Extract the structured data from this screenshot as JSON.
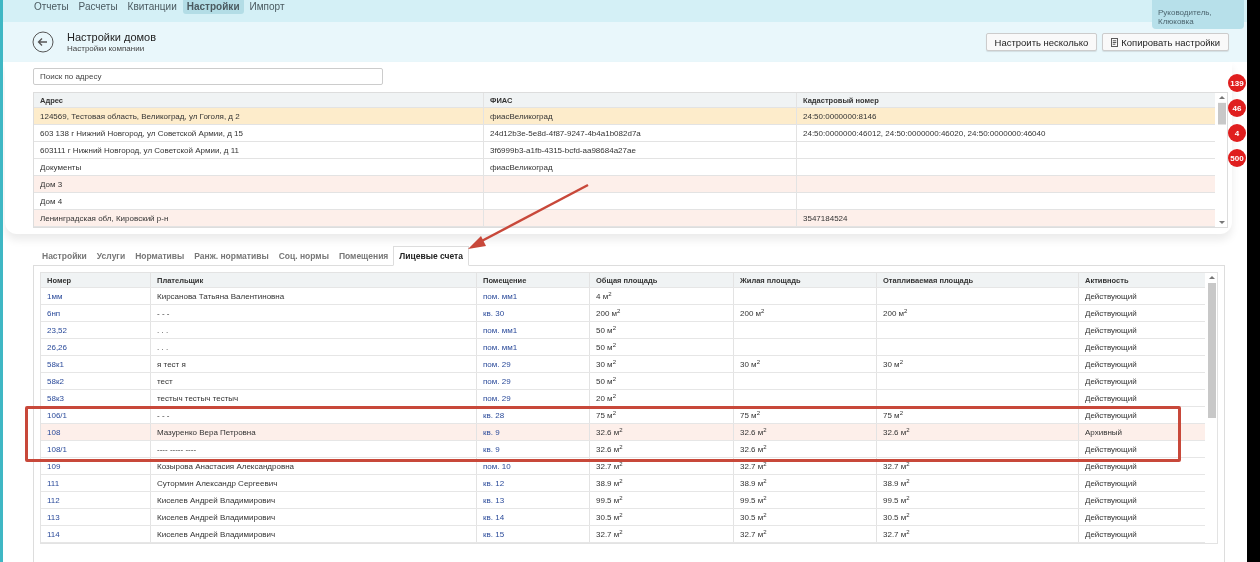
{
  "nav": {
    "items": [
      {
        "label": "Отчеты",
        "selected": false
      },
      {
        "label": "Расчеты",
        "selected": false
      },
      {
        "label": "Квитанции",
        "selected": false
      },
      {
        "label": "Настройки",
        "selected": true
      },
      {
        "label": "Импорт",
        "selected": false
      }
    ],
    "user_role": "Руководитель, Клюковка"
  },
  "header": {
    "title": "Настройки домов",
    "subtitle": "Настройки компании",
    "buttons": [
      {
        "label": "Настроить несколько",
        "kind": "plain"
      },
      {
        "label": "Копировать настройки",
        "kind": "copy"
      }
    ]
  },
  "badges": [
    "139",
    "46",
    "4",
    "500"
  ],
  "search": {
    "placeholder": "Поиск по адресу"
  },
  "houses": {
    "columns": [
      "Адрес",
      "ФИАС",
      "Кадастровый номер"
    ],
    "rows": [
      {
        "cells": [
          "124569, Тестовая область, Великоград, ул Гоголя, д 2",
          "фиасВеликоград",
          "24:50:0000000:8146"
        ],
        "selected": true,
        "highlighted": false
      },
      {
        "cells": [
          "603 138 г Нижний Новгород, ул Советской Армии, д 15",
          "24d12b3e-5e8d-4f87-9247-4b4a1b082d7a",
          "24:50:0000000:46012, 24:50:0000000:46020, 24:50:0000000:46040"
        ],
        "selected": false,
        "highlighted": false
      },
      {
        "cells": [
          "603111 г Нижний Новгород, ул Советской Армии, д 11",
          "3f6999b3-a1fb-4315-bcfd-aa98684a27ae",
          ""
        ],
        "selected": false,
        "highlighted": false
      },
      {
        "cells": [
          "Документы",
          "фиасВеликоград",
          ""
        ],
        "selected": false,
        "highlighted": false
      },
      {
        "cells": [
          "Дом 3",
          "",
          ""
        ],
        "selected": false,
        "highlighted": true
      },
      {
        "cells": [
          "Дом 4",
          "",
          ""
        ],
        "selected": false,
        "highlighted": false
      },
      {
        "cells": [
          "Ленинградская обл, Кировский р-н",
          "",
          "3547184524"
        ],
        "selected": false,
        "highlighted": true
      }
    ]
  },
  "tabs": [
    {
      "label": "Настройки",
      "selected": false
    },
    {
      "label": "Услуги",
      "selected": false
    },
    {
      "label": "Нормативы",
      "selected": false
    },
    {
      "label": "Ранж. нормативы",
      "selected": false
    },
    {
      "label": "Соц. нормы",
      "selected": false
    },
    {
      "label": "Помещения",
      "selected": false
    },
    {
      "label": "Лицевые счета",
      "selected": true
    }
  ],
  "accounts": {
    "columns": [
      "Номер",
      "Плательщик",
      "Помещение",
      "Общая площадь",
      "Жилая площадь",
      "Отапливаемая площадь",
      "Активность"
    ],
    "rows": [
      {
        "number": "1мм",
        "payer": "Кирсанова Татьяна Валентиновна",
        "room": "пом. мм1",
        "total": "4 м$^{2}$",
        "living": "",
        "heated": "",
        "activity": "Действующий",
        "highlighted": false
      },
      {
        "number": "6нп",
        "payer": "- - -",
        "room": "кв. 30",
        "total": "200 м$^{2}$",
        "living": "200 м$^{2}$",
        "heated": "200 м$^{2}$",
        "activity": "Действующий",
        "highlighted": false
      },
      {
        "number": "23,52",
        "payer": ". . .",
        "room": "пом. мм1",
        "total": "50 м$^{2}$",
        "living": "",
        "heated": "",
        "activity": "Действующий",
        "highlighted": false
      },
      {
        "number": "26,26",
        "payer": ". . .",
        "room": "пом. мм1",
        "total": "50 м$^{2}$",
        "living": "",
        "heated": "",
        "activity": "Действующий",
        "highlighted": false
      },
      {
        "number": "58к1",
        "payer": "я тест я",
        "room": "пом. 29",
        "total": "30 м$^{2}$",
        "living": "30 м$^{2}$",
        "heated": "30 м$^{2}$",
        "activity": "Действующий",
        "highlighted": false
      },
      {
        "number": "58к2",
        "payer": "тест",
        "room": "пом. 29",
        "total": "50 м$^{2}$",
        "living": "",
        "heated": "",
        "activity": "Действующий",
        "highlighted": false
      },
      {
        "number": "58к3",
        "payer": "тестыч тестыч тестыч",
        "room": "пом. 29",
        "total": "20 м$^{2}$",
        "living": "",
        "heated": "",
        "activity": "Действующий",
        "highlighted": false
      },
      {
        "number": "106/1",
        "payer": "- - -",
        "room": "кв. 28",
        "total": "75 м$^{2}$",
        "living": "75 м$^{2}$",
        "heated": "75 м$^{2}$",
        "activity": "Действующий",
        "highlighted": false
      },
      {
        "number": "108",
        "payer": "Мазуренко Вера Петровна",
        "room": "кв. 9",
        "total": "32.6 м$^{2}$",
        "living": "32.6 м$^{2}$",
        "heated": "32.6 м$^{2}$",
        "activity": "Архивный",
        "highlighted": true
      },
      {
        "number": "108/1",
        "payer": "---- ----- ----",
        "room": "кв. 9",
        "total": "32.6 м$^{2}$",
        "living": "32.6 м$^{2}$",
        "heated": "",
        "activity": "Действующий",
        "highlighted": false
      },
      {
        "number": "109",
        "payer": "Козырова Анастасия Александровна",
        "room": "пом. 10",
        "total": "32.7 м$^{2}$",
        "living": "32.7 м$^{2}$",
        "heated": "32.7 м$^{2}$",
        "activity": "Действующий",
        "highlighted": false
      },
      {
        "number": "111",
        "payer": "Сутормин Александр Сергеевич",
        "room": "кв. 12",
        "total": "38.9 м$^{2}$",
        "living": "38.9 м$^{2}$",
        "heated": "38.9 м$^{2}$",
        "activity": "Действующий",
        "highlighted": false
      },
      {
        "number": "112",
        "payer": "Киселев Андрей Владимирович",
        "room": "кв. 13",
        "total": "99.5 м$^{2}$",
        "living": "99.5 м$^{2}$",
        "heated": "99.5 м$^{2}$",
        "activity": "Действующий",
        "highlighted": false
      },
      {
        "number": "113",
        "payer": "Киселев Андрей Владимирович",
        "room": "кв. 14",
        "total": "30.5 м$^{2}$",
        "living": "30.5 м$^{2}$",
        "heated": "30.5 м$^{2}$",
        "activity": "Действующий",
        "highlighted": false
      },
      {
        "number": "114",
        "payer": "Киселев Андрей Владимирович",
        "room": "кв. 15",
        "total": "32.7 м$^{2}$",
        "living": "32.7 м$^{2}$",
        "heated": "32.7 м$^{2}$",
        "activity": "Действующий",
        "highlighted": false
      }
    ]
  }
}
